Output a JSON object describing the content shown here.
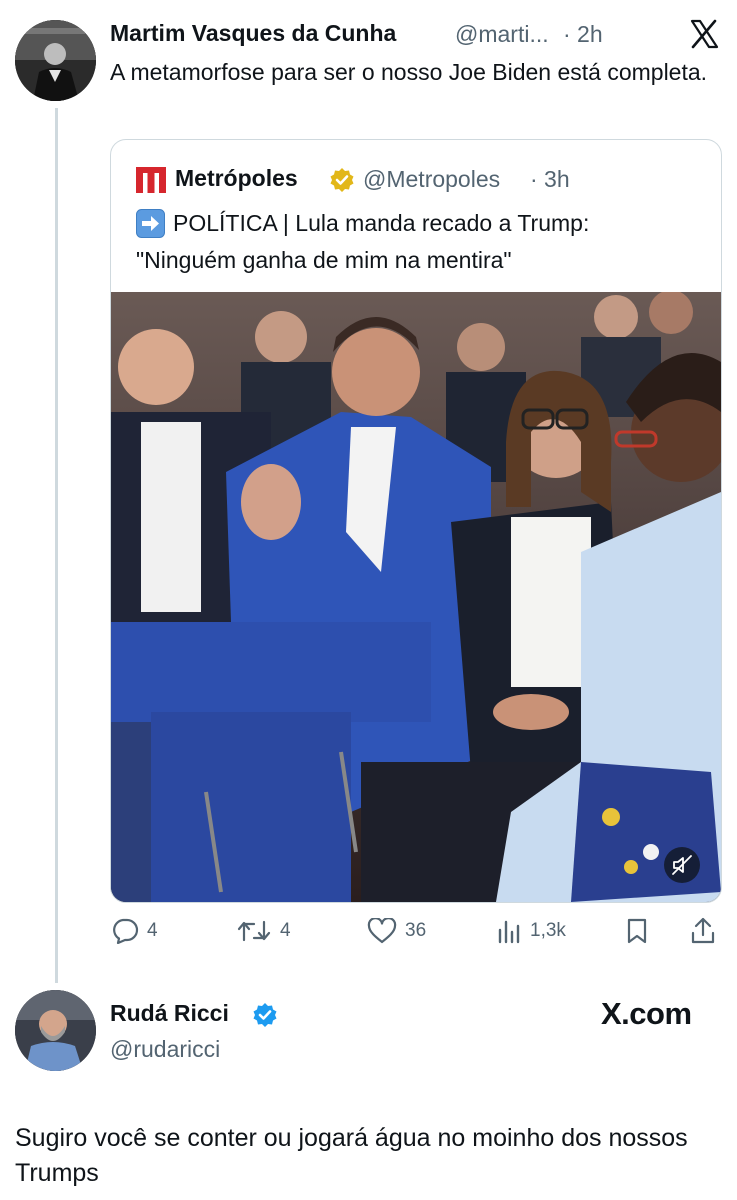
{
  "tweet": {
    "author_name": "Martim Vasques da Cunha",
    "author_handle": "@marti...",
    "time": "· 2h",
    "text": "A metamorfose para ser o nosso Joe Biden está completa.",
    "platform_logo": "X"
  },
  "quoted": {
    "author_name": "Metrópoles",
    "author_handle": "@Metropoles",
    "time": "· 3h",
    "text_line1": "POLÍTICA | Lula manda recado a Trump:",
    "text_line2": "\"Ninguém ganha de mim na mentira\"",
    "logo_letter": "m",
    "brand_color": "#d6262d",
    "verified_color": "#e2b719"
  },
  "actions": {
    "replies": "4",
    "retweets": "4",
    "likes": "36",
    "views": "1,3k"
  },
  "reply": {
    "author_name": "Rudá Ricci",
    "author_handle": "@rudaricci",
    "watermark": "X.com",
    "text": "Sugiro você se conter ou jogará água no moinho dos nossos Trumps",
    "verified_color": "#1d9bf0"
  },
  "icons": [
    "close-x-icon",
    "verified-badge-icon",
    "arrow-right-emoji-icon",
    "mute-icon",
    "reply-icon",
    "retweet-icon",
    "like-icon",
    "views-icon",
    "bookmark-icon",
    "share-icon"
  ]
}
